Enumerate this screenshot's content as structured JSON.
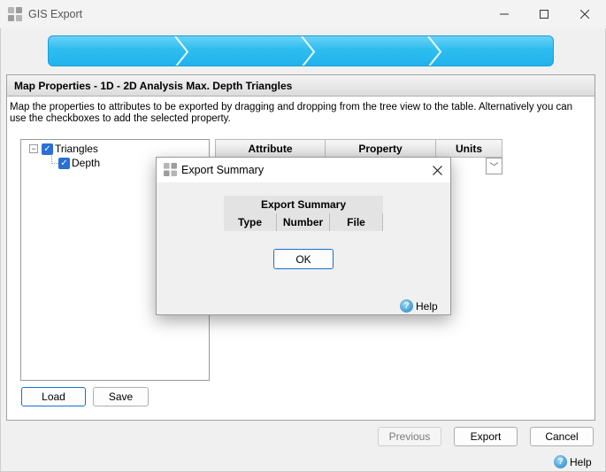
{
  "window": {
    "title": "GIS Export",
    "icon": "app-grid-icon"
  },
  "panel": {
    "title": "Map Properties - 1D - 2D Analysis Max. Depth Triangles",
    "description": "Map the properties to attributes to be exported by dragging and dropping from the tree view to the table. Alternatively you can use the checkboxes to add the selected property."
  },
  "tree": {
    "root": {
      "label": "Triangles",
      "checked": true,
      "expanded": true
    },
    "children": [
      {
        "label": "Depth",
        "checked": true
      }
    ]
  },
  "grid": {
    "columns": [
      "Attribute",
      "Property",
      "Units"
    ]
  },
  "tree_buttons": {
    "load": "Load",
    "save": "Save"
  },
  "footer": {
    "previous": "Previous",
    "export": "Export",
    "cancel": "Cancel",
    "help": "Help"
  },
  "modal": {
    "title": "Export Summary",
    "table_title": "Export Summary",
    "columns": [
      "Type",
      "Number",
      "File"
    ],
    "ok": "OK",
    "help": "Help"
  },
  "colors": {
    "wizard": "#2fbdf0",
    "accent": "#1a6fd0",
    "checkbox": "#2b6fd6"
  }
}
